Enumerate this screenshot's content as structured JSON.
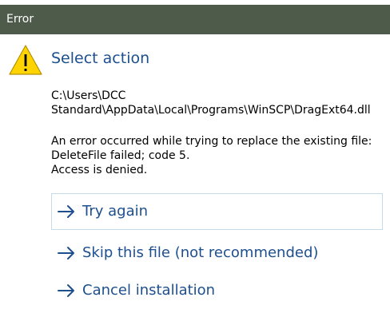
{
  "window": {
    "title": "Error"
  },
  "dialog": {
    "heading": "Select action",
    "path_line1": "C:\\Users\\DCC",
    "path_line2": "Standard\\AppData\\Local\\Programs\\WinSCP\\DragExt64.dll",
    "message_line1": "An error occurred while trying to replace the existing file:",
    "message_line2": "DeleteFile failed; code 5.",
    "message_line3": "Access is denied.",
    "icon": "warning-icon",
    "colors": {
      "titlebar": "#4e5a4a",
      "accent": "#1d4f8f",
      "warning_fill": "#ffd400"
    }
  },
  "actions": [
    {
      "label": "Try again",
      "icon": "arrow-right-icon",
      "focused": true
    },
    {
      "label": "Skip this file (not recommended)",
      "icon": "arrow-right-icon",
      "focused": false
    },
    {
      "label": "Cancel installation",
      "icon": "arrow-right-icon",
      "focused": false
    }
  ]
}
